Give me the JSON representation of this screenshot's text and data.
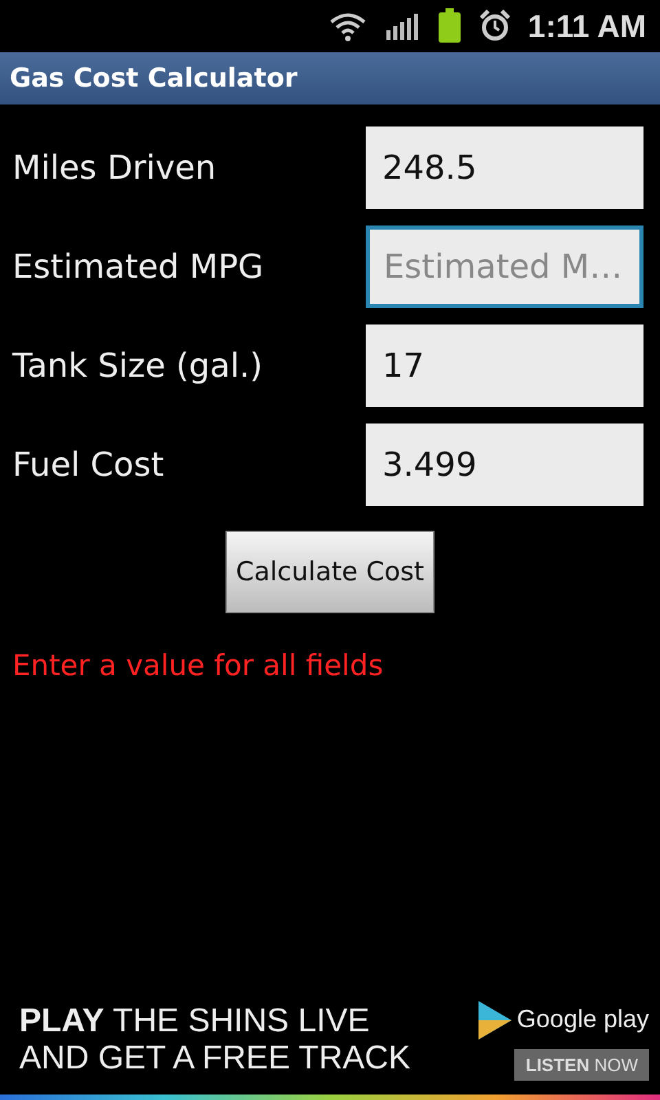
{
  "status_bar": {
    "time": "1:11 AM"
  },
  "title_bar": {
    "title": "Gas Cost Calculator"
  },
  "form": {
    "rows": [
      {
        "label": "Miles Driven",
        "value": "248.5",
        "placeholder": null,
        "focused": false
      },
      {
        "label": "Estimated MPG",
        "value": null,
        "placeholder": "Estimated M…",
        "focused": true
      },
      {
        "label": "Tank Size (gal.)",
        "value": "17",
        "placeholder": null,
        "focused": false
      },
      {
        "label": "Fuel Cost",
        "value": "3.499",
        "placeholder": null,
        "focused": false
      }
    ],
    "button": "Calculate Cost",
    "error": "Enter a value for all fields"
  },
  "ad": {
    "lines": [
      "**PLAY** THE SHINS LIVE",
      "AND GET A FREE TRACK"
    ],
    "store": "Google play",
    "action": "**LISTEN** NOW"
  }
}
